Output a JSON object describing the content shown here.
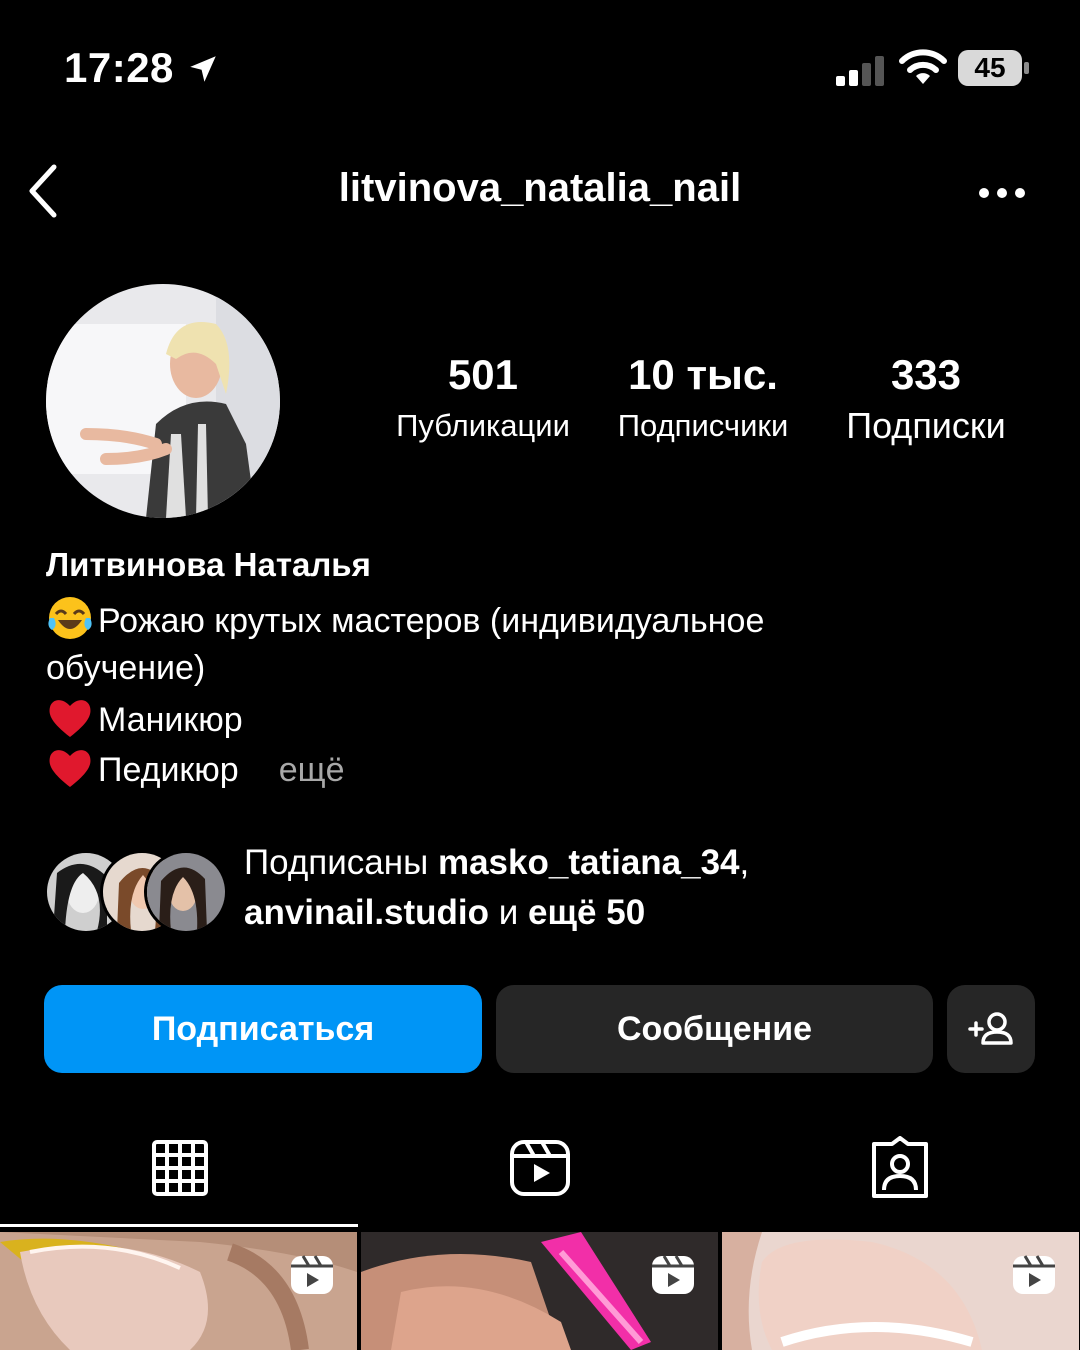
{
  "status_bar": {
    "time": "17:28",
    "battery": "45"
  },
  "header": {
    "username": "litvinova_natalia_nail"
  },
  "stats": [
    {
      "value": "501",
      "label": "Публикации"
    },
    {
      "value": "10 тыс.",
      "label": "Подписчики"
    },
    {
      "value": "333",
      "label": "Подписки"
    }
  ],
  "bio": {
    "name": "Литвинова Наталья",
    "line1": "Рожаю крутых мастеров (индивидуальное",
    "line2": "обучение)",
    "line3": "Маникюр",
    "line4": "Педикюр",
    "more": "ещё"
  },
  "followed_by": {
    "prefix": "Подписаны ",
    "user1": "masko_tatiana_34",
    "sep": ",",
    "user2": "anvinail.studio",
    "mid": " и ",
    "rest": "ещё 50"
  },
  "buttons": {
    "follow": "Подписаться",
    "message": "Сообщение"
  },
  "colors": {
    "accent": "#0095f6",
    "button_dark": "#262626",
    "muted": "#a8a8a8"
  }
}
